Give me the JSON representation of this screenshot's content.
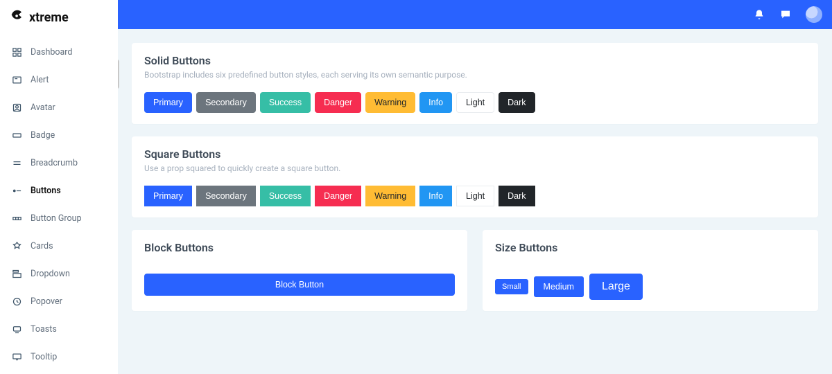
{
  "brand": "xtreme",
  "nav": [
    {
      "label": "Dashboard",
      "icon": "dashboard-icon"
    },
    {
      "label": "Alert",
      "icon": "alert-icon"
    },
    {
      "label": "Avatar",
      "icon": "avatar-icon"
    },
    {
      "label": "Badge",
      "icon": "badge-icon"
    },
    {
      "label": "Breadcrumb",
      "icon": "breadcrumb-icon"
    },
    {
      "label": "Buttons",
      "icon": "buttons-icon",
      "active": true
    },
    {
      "label": "Button Group",
      "icon": "button-group-icon"
    },
    {
      "label": "Cards",
      "icon": "cards-icon"
    },
    {
      "label": "Dropdown",
      "icon": "dropdown-icon"
    },
    {
      "label": "Popover",
      "icon": "popover-icon"
    },
    {
      "label": "Toasts",
      "icon": "toasts-icon"
    },
    {
      "label": "Tooltip",
      "icon": "tooltip-icon"
    }
  ],
  "cards": {
    "solid": {
      "title": "Solid Buttons",
      "subtitle": "Bootstrap includes six predefined button styles, each serving its own semantic purpose."
    },
    "square": {
      "title": "Square Buttons",
      "subtitle": "Use a prop squared to quickly create a square button."
    },
    "block": {
      "title": "Block Buttons",
      "button": "Block Button"
    },
    "size": {
      "title": "Size Buttons",
      "small": "Small",
      "medium": "Medium",
      "large": "Large"
    }
  },
  "variants": {
    "primary": "Primary",
    "secondary": "Secondary",
    "success": "Success",
    "danger": "Danger",
    "warning": "Warning",
    "info": "Info",
    "light": "Light",
    "dark": "Dark"
  },
  "colors": {
    "primary": "#2962ff",
    "secondary": "#6c757d",
    "success": "#36bea6",
    "danger": "#f62d51",
    "warning": "#ffbc34",
    "info": "#2196f3",
    "light": "#ffffff",
    "dark": "#212529"
  }
}
